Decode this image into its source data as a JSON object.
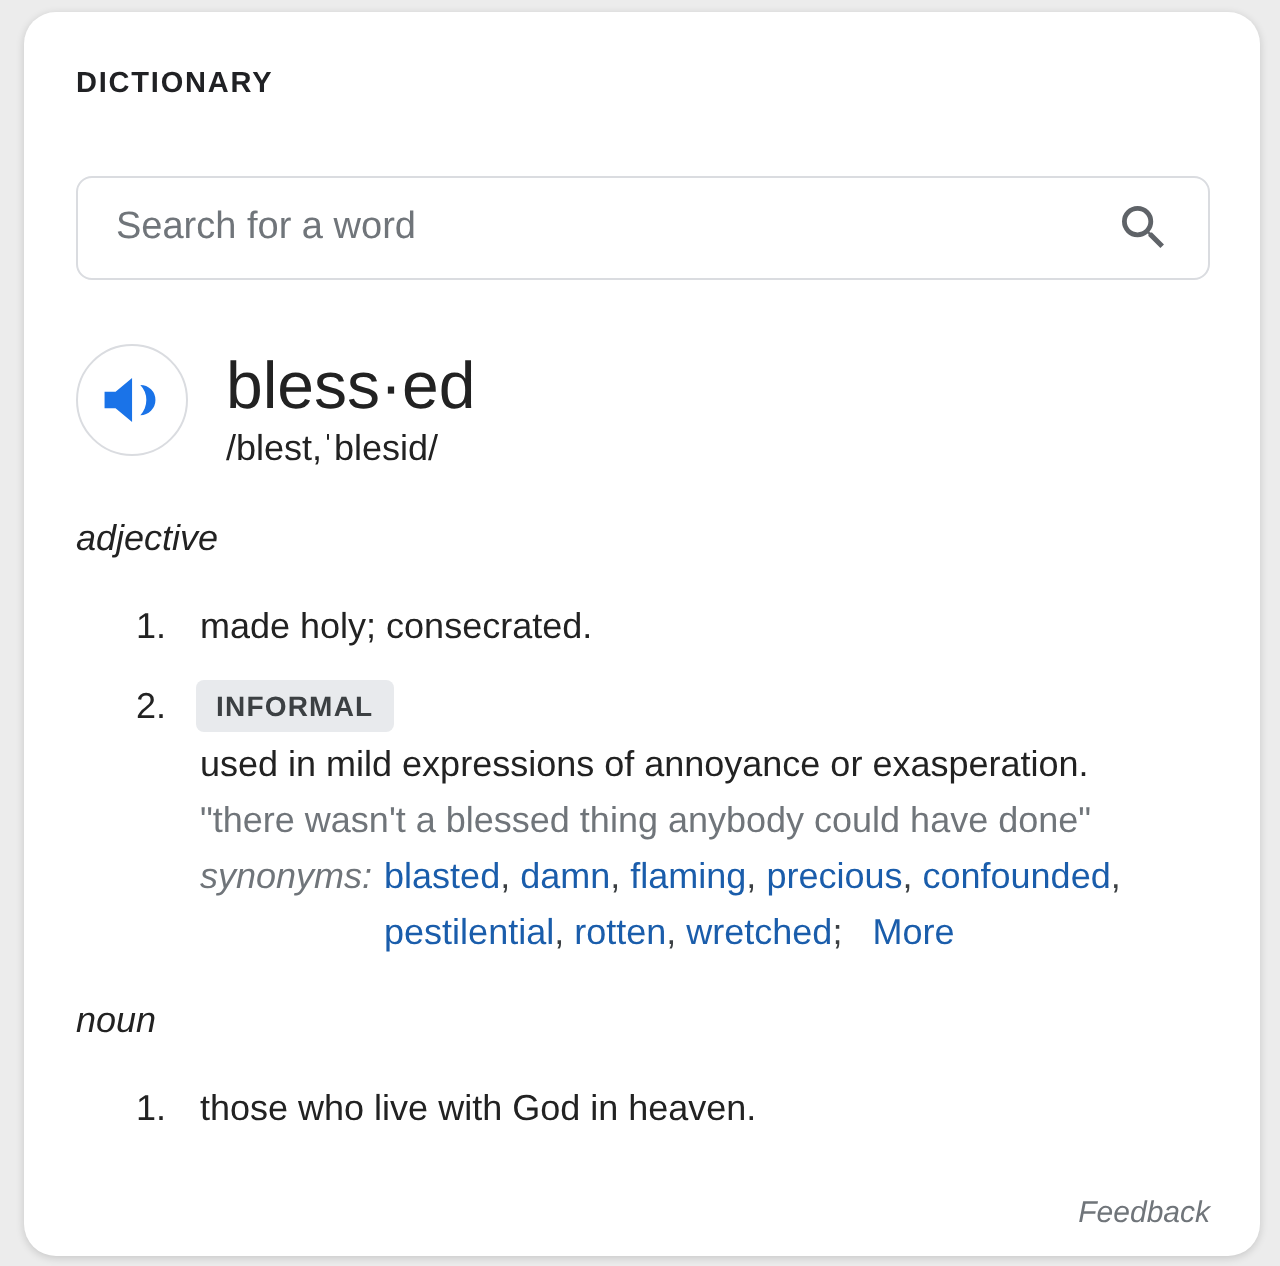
{
  "header": {
    "title": "DICTIONARY"
  },
  "search": {
    "placeholder": "Search for a word"
  },
  "entry": {
    "headword": "bless·ed",
    "pronunciation": "/blest,ˈblesid/"
  },
  "senses": [
    {
      "part_of_speech": "adjective",
      "definitions": [
        {
          "number": "1.",
          "text": "made holy; consecrated."
        },
        {
          "number": "2.",
          "register": "INFORMAL",
          "text": "used in mild expressions of annoyance or exasperation.",
          "example": "\"there wasn't a blessed thing anybody could have done\"",
          "synonyms_label": "synonyms:",
          "synonyms": [
            {
              "word": "blasted",
              "separator": ","
            },
            {
              "word": "damn",
              "separator": ","
            },
            {
              "word": "flaming",
              "separator": ","
            },
            {
              "word": "precious",
              "separator": ","
            },
            {
              "word": "confounded",
              "separator": ","
            },
            {
              "word": "pestilential",
              "separator": ","
            },
            {
              "word": "rotten",
              "separator": ","
            },
            {
              "word": "wretched",
              "separator": ";"
            }
          ],
          "more": "More"
        }
      ]
    },
    {
      "part_of_speech": "noun",
      "definitions": [
        {
          "number": "1.",
          "text": "those who live with God in heaven."
        }
      ]
    }
  ],
  "footer": {
    "feedback": "Feedback"
  }
}
